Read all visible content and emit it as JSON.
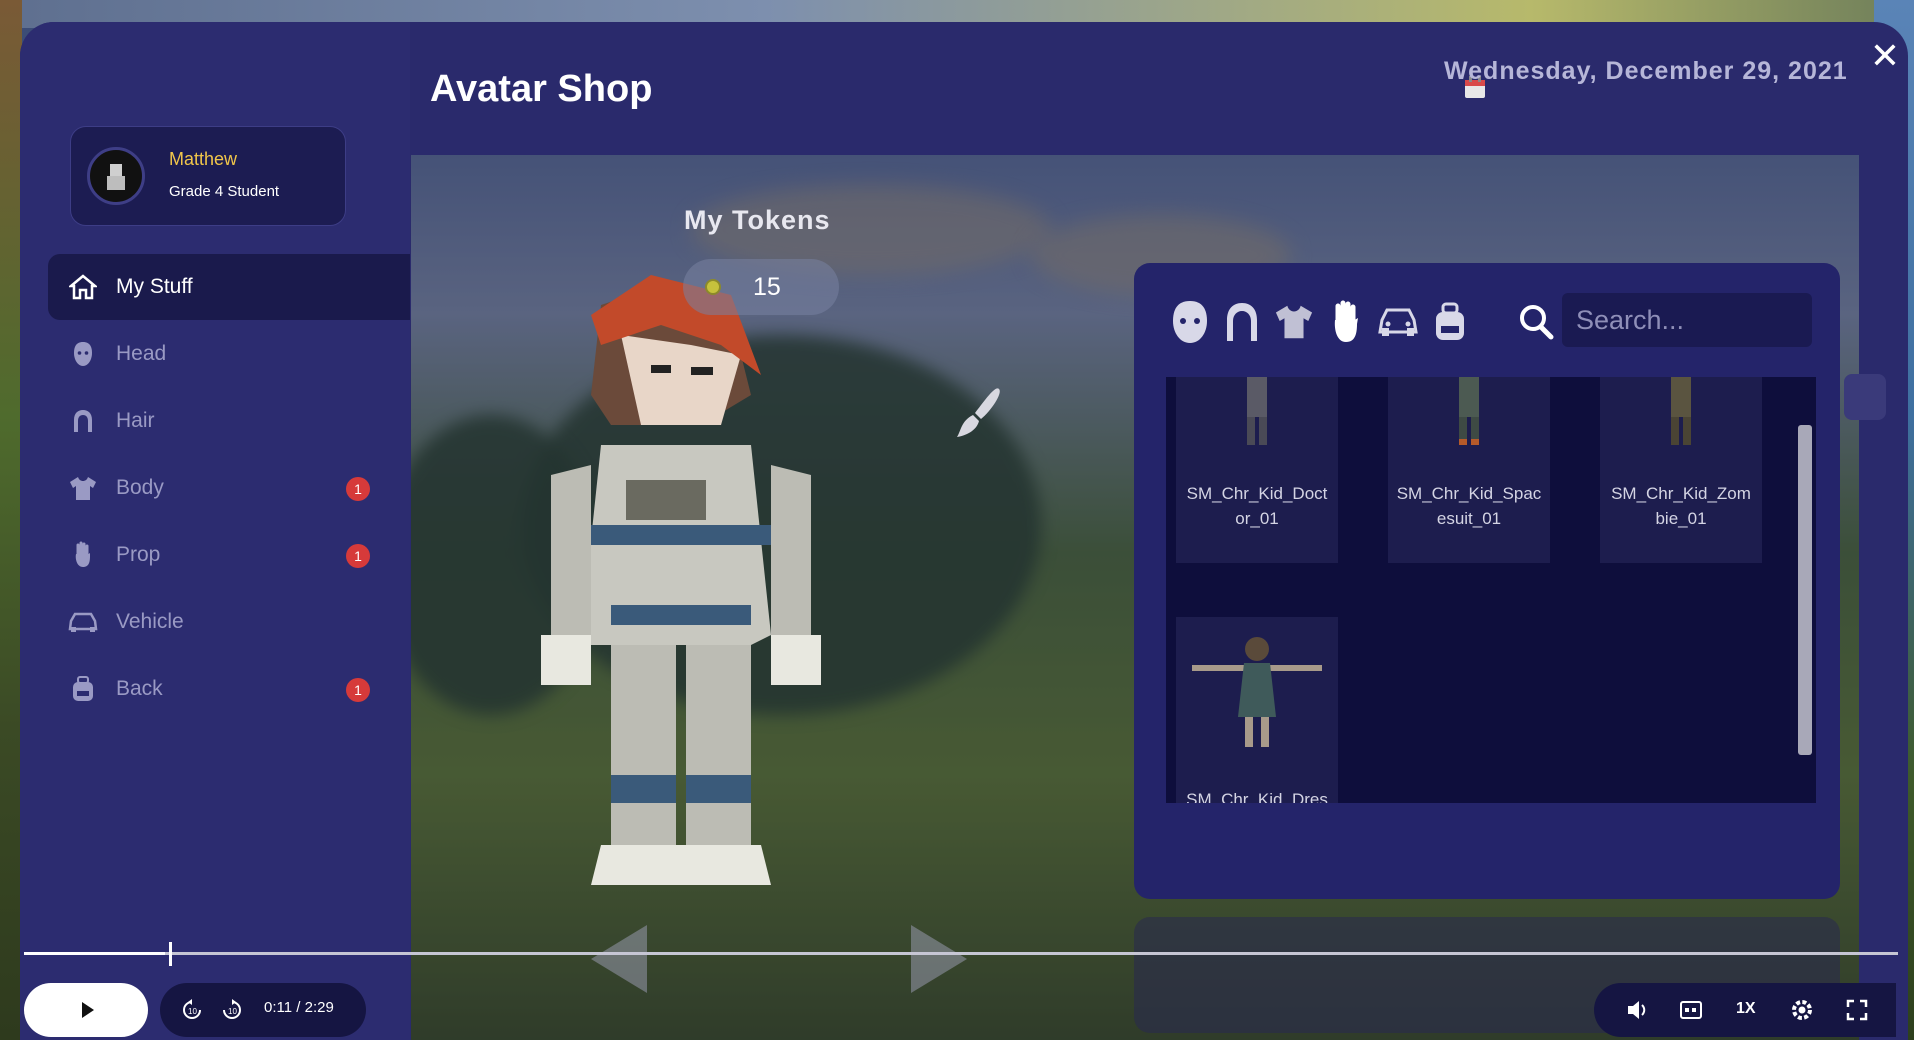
{
  "window": {
    "close_label": "✕"
  },
  "header": {
    "title": "Avatar Shop",
    "date": "Wednesday, December 29, 2021"
  },
  "profile": {
    "name": "Matthew",
    "role": "Grade 4 Student"
  },
  "sidebar": {
    "items": [
      {
        "label": "My Stuff",
        "icon": "home-icon",
        "active": true,
        "badge": ""
      },
      {
        "label": "Head",
        "icon": "head-icon",
        "badge": ""
      },
      {
        "label": "Hair",
        "icon": "hair-icon",
        "badge": ""
      },
      {
        "label": "Body",
        "icon": "shirt-icon",
        "badge": "1"
      },
      {
        "label": "Prop",
        "icon": "hand-icon",
        "badge": "1"
      },
      {
        "label": "Vehicle",
        "icon": "car-icon",
        "badge": ""
      },
      {
        "label": "Back",
        "icon": "backpack-icon",
        "badge": "1"
      }
    ]
  },
  "tokens": {
    "label": "My Tokens",
    "value": "15"
  },
  "shop": {
    "categories": [
      "head-icon",
      "hair-icon",
      "shirt-icon",
      "hand-icon",
      "car-icon",
      "backpack-icon"
    ],
    "search_placeholder": "Search...",
    "items": [
      {
        "label_line1": "SM_Chr_Kid_Doct",
        "label_line2": "or_01"
      },
      {
        "label_line1": "SM_Chr_Kid_Spac",
        "label_line2": "esuit_01"
      },
      {
        "label_line1": "SM_Chr_Kid_Zom",
        "label_line2": "bie_01"
      },
      {
        "label_line1": "SM_Chr_Kid_Dres",
        "label_line2": ""
      }
    ]
  },
  "player": {
    "current_time": "0:11",
    "total_time": "/ 2:29",
    "speed": "1X",
    "progress": 0.075
  },
  "colors": {
    "accent": "#f1c64a",
    "badge": "#d63a3a",
    "panel": "#24246a",
    "modal": "#2a2a6c"
  }
}
